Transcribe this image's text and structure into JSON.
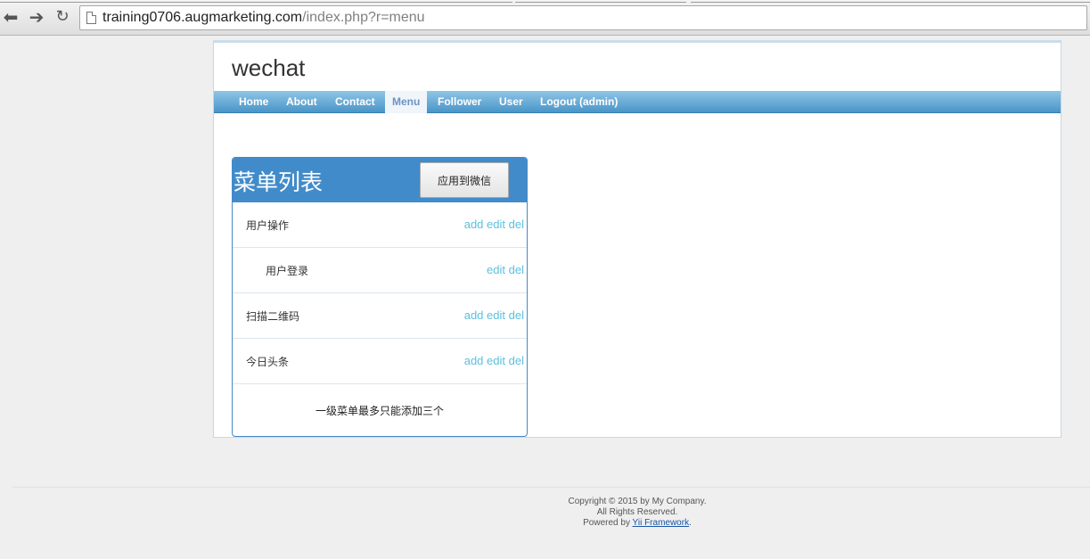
{
  "browser": {
    "url_host": "training0706.augmarketing.com",
    "url_path": "/index.php?r=menu",
    "back_icon": "back-arrow-icon",
    "forward_icon": "forward-arrow-icon",
    "reload_icon": "reload-icon"
  },
  "header": {
    "logo": "wechat"
  },
  "nav": {
    "items": [
      {
        "label": "Home"
      },
      {
        "label": "About"
      },
      {
        "label": "Contact"
      },
      {
        "label": "Menu",
        "active": true
      },
      {
        "label": "Follower"
      },
      {
        "label": "User"
      },
      {
        "label": "Logout (admin)"
      }
    ]
  },
  "panel": {
    "title": "菜单列表",
    "apply_button": "应用到微信",
    "rows": [
      {
        "label": "用户操作",
        "add": "add",
        "edit": "edit",
        "del": "del"
      },
      {
        "label": "用户登录",
        "edit": "edit",
        "del": "del",
        "child": true
      },
      {
        "label": "扫描二维码",
        "add": "add",
        "edit": "edit",
        "del": "del"
      },
      {
        "label": "今日头条",
        "add": "add",
        "edit": "edit",
        "del": "del"
      }
    ],
    "note": "一级菜单最多只能添加三个"
  },
  "footer": {
    "line1": "Copyright © 2015 by My Company.",
    "line2": "All Rights Reserved.",
    "powered_prefix": "Powered by ",
    "powered_link": "Yii Framework",
    "powered_suffix": "."
  },
  "colors": {
    "nav_gradient_top": "#8fc5e6",
    "nav_gradient_bottom": "#4a95c8",
    "panel_header": "#428bca",
    "action_link": "#5bc0de",
    "footer_link": "#1a55a6"
  }
}
